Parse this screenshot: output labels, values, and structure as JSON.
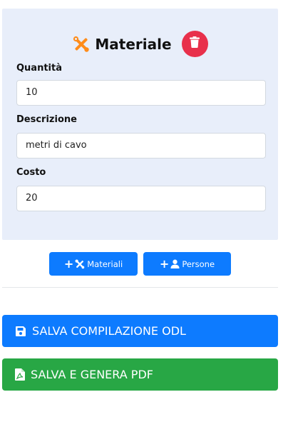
{
  "card": {
    "title": "Materiale",
    "title_icon": "tools-icon",
    "delete_icon": "trash-icon",
    "accent_color": "#ff8c1a",
    "delete_color": "#e8304b",
    "background": "#e8eefa"
  },
  "fields": {
    "quantita": {
      "label": "Quantità",
      "value": "10"
    },
    "descrizione": {
      "label": "Descrizione",
      "value": "metri di cavo"
    },
    "costo": {
      "label": "Costo",
      "value": "20"
    }
  },
  "actions": {
    "add_materiali": {
      "plus": "+",
      "icon": "tools-icon",
      "label": "Materiali"
    },
    "add_persone": {
      "plus": "+",
      "icon": "user-icon",
      "label": "Persone"
    }
  },
  "footer": {
    "save": {
      "icon": "save-icon",
      "label": "SALVA COMPILAZIONE ODL",
      "color": "#0d7bff"
    },
    "save_pdf": {
      "icon": "pdf-icon",
      "label": "SALVA E GENERA PDF",
      "color": "#28a745"
    }
  }
}
